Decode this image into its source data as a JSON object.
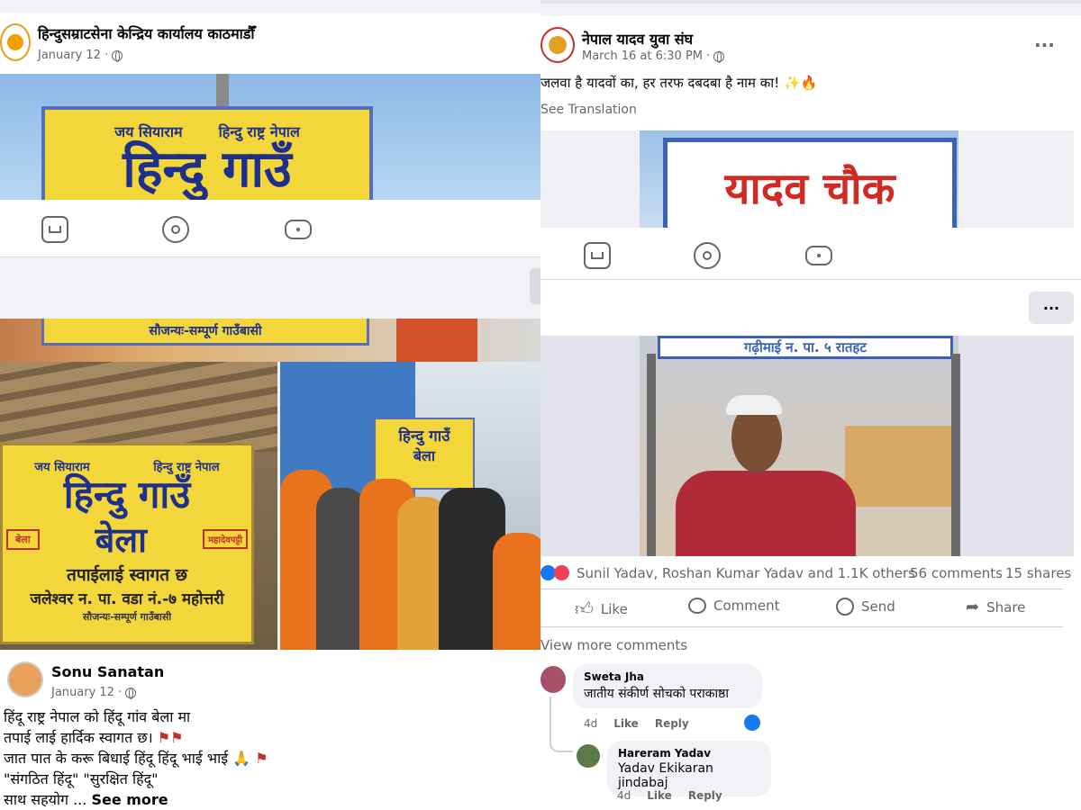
{
  "left_post1": {
    "page_name": "हिन्दुसम्राटसेना केन्द्रिय कार्यालय काठमाडौँ",
    "date": "January 12 ·",
    "sign_small_left": "जय सियाराम",
    "sign_small_right": "हिन्दु राष्ट्र नेपाल",
    "sign_big": "हिन्दु गाउँ",
    "nav_icons": [
      "marketplace-icon",
      "groups-icon",
      "gaming-icon"
    ]
  },
  "left_post2": {
    "sign_bottom_strip": "सौजन्यः-सम्पूर्ण गाउँबासी",
    "sign_top": "जय सियाराम",
    "sign_top_right": "हिन्दु राष्ट्र नेपाल",
    "sign_title": "हिन्दु गाउँ",
    "sign_village": "बेला",
    "sign_arrow_left": "बेला",
    "sign_arrow_right": "महादेवपट्टी",
    "sign_welcome": "तपाईलाई स्वागत छ",
    "sign_address": "जलेश्वर न. पा. वडा नं.-७ महोत्तरी",
    "sign_credit": "सौजन्यः-सम्पूर्ण गाउँबासी",
    "photo_sign_title": "हिन्दु गाउँ",
    "photo_sign_village": "बेला",
    "author": "Sonu Sanatan",
    "date": "January 12 ·",
    "text_line1": "हिंदू राष्ट्र नेपाल को हिंदू गांव बेला मा",
    "text_line2": "तपाई लाई हार्दिक स्वागत छ।",
    "text_line3": "जात पात के करू बिधाई हिंदू हिंदू भाई भाई",
    "text_line4": "\"संगठित हिंदू\" \"सुरक्षित हिंदू\"",
    "text_line5": "साथ सहयोग ...",
    "see_more": "See more"
  },
  "right_post": {
    "page_name": "नेपाल यादव युवा संघ",
    "date": "March 16 at 6:30 PM ·",
    "more": "···",
    "text": "जलवा है यादवों का, हर तरफ दबदबा है नाम का! ✨🔥",
    "see_translation": "See Translation",
    "sign_text": "यादव चौक",
    "nav_icons": [
      "marketplace-icon",
      "groups-icon",
      "gaming-icon"
    ],
    "more2": "···",
    "photo_sign_text": "गढ़ीमाई न. पा. ५ रातहट",
    "reactions_text": "Sunil Yadav, Roshan Kumar Yadav and 1.1K others",
    "comments_count": "56 comments",
    "shares_count": "15 shares",
    "actions": {
      "like": "Like",
      "comment": "Comment",
      "send": "Send",
      "share": "Share"
    },
    "view_more": "View more comments",
    "comments": [
      {
        "name": "Sweta Jha",
        "text": "जातीय संकीर्ण सोचको पराकाष्ठा",
        "time": "4d",
        "like": "Like",
        "reply": "Reply"
      },
      {
        "name": "Hareram Yadav",
        "text": "Yadav Ekikaran jindabaj",
        "time": "4d",
        "like": "Like",
        "reply": "Reply"
      }
    ]
  },
  "colors": {
    "accent": "#1877f2",
    "sign_yellow": "#f2d63a",
    "saffron": "#e8731c"
  }
}
